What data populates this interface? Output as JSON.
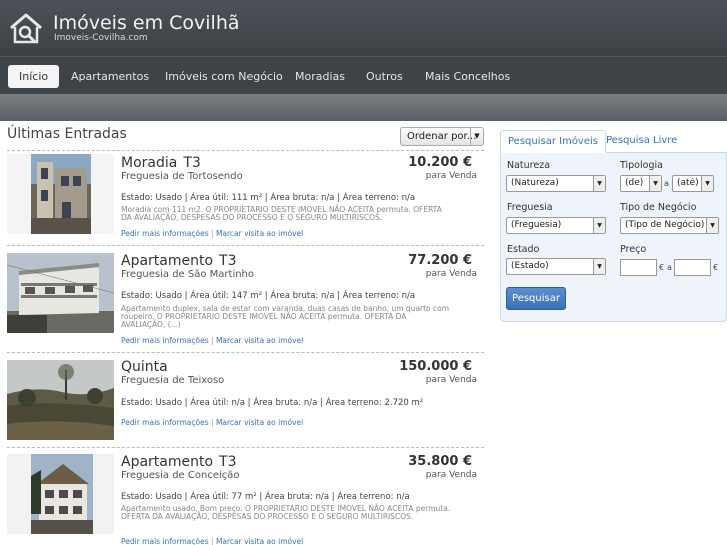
{
  "header": {
    "title": "Imóveis em Covilhã",
    "subtitle": "Imoveis-Covilha.com",
    "logo_icon": "house-search-icon"
  },
  "nav": {
    "items": [
      "Início",
      "Apartamentos",
      "Imóveis com Negócio",
      "Moradias",
      "Outros",
      "Mais Concelhos"
    ],
    "active": "Início"
  },
  "listings_section": {
    "title": "Últimas Entradas",
    "sort_label": "Ordenar por...",
    "link_request": "Pedir mais informações",
    "link_separator": "|",
    "link_visit": "Marcar visita ao imóvel"
  },
  "listings": [
    {
      "type": "Moradia",
      "typology": "T3",
      "parish": "Freguesia de Tortosendo",
      "price": "10.200 €",
      "deal": "para Venda",
      "details": "Estado: Usado  | Área útil: 111 m²  | Área bruta: n/a  | Área terreno: n/a",
      "description": "Moradia com 111 m2. O PROPRIETARIO DESTE IMOVEL NÃO ACEITA permuta. OFERTA DA AVALIAÇÃO, DESPESAS DO PROCESSO E O SEGURO MULTIRISCOS."
    },
    {
      "type": "Apartamento",
      "typology": "T3",
      "parish": "Freguesia de São Martinho",
      "price": "77.200 €",
      "deal": "para Venda",
      "details": "Estado: Usado  | Área útil: 147 m²  | Área bruta: n/a  | Área terreno: n/a",
      "description": "Apartamento duplex, sala de estar com varanda, duas casas de banho, um quarto com roupeiro. O PROPRIETARIO DESTE IMOVEL NÃO ACEITA permuta. OFERTA DA AVALIAÇÃO, (...)"
    },
    {
      "type": "Quinta",
      "typology": "",
      "parish": "Freguesia de Teixoso",
      "price": "150.000 €",
      "deal": "para Venda",
      "details": "Estado: Usado  | Área útil: n/a  | Área bruta: n/a  | Área terreno: 2.720 m²",
      "description": ""
    },
    {
      "type": "Apartamento",
      "typology": "T3",
      "parish": "Freguesia de Conceição",
      "price": "35.800 €",
      "deal": "para Venda",
      "details": "Estado: Usado  | Área útil: 77 m²  | Área bruta: n/a  | Área terreno: n/a",
      "description": "Apartamento usado. Bom preço. O PROPRIETARIO DESTE IMOVEL NÃO ACEITA permuta. OFERTA DA AVALIAÇÃO, DESPESAS DO PROCESSO E O SEGURO MULTIRISCOS."
    }
  ],
  "search": {
    "tabs": [
      "Pesquisar Imóveis",
      "Pesquisa Livre"
    ],
    "labels": {
      "natureza": "Natureza",
      "tipologia": "Tipologia",
      "freguesia": "Freguesia",
      "tipo_negocio": "Tipo de Negócio",
      "estado": "Estado",
      "preco": "Preço"
    },
    "values": {
      "natureza": "(Natureza)",
      "tipologia_de": "(de)",
      "tipologia_ate": "(até)",
      "freguesia": "(Freguesia)",
      "tipo_negocio": "(Tipo de Negócio)",
      "estado": "(Estado)"
    },
    "connector": "a",
    "currency": "€",
    "button": "Pesquisar"
  }
}
